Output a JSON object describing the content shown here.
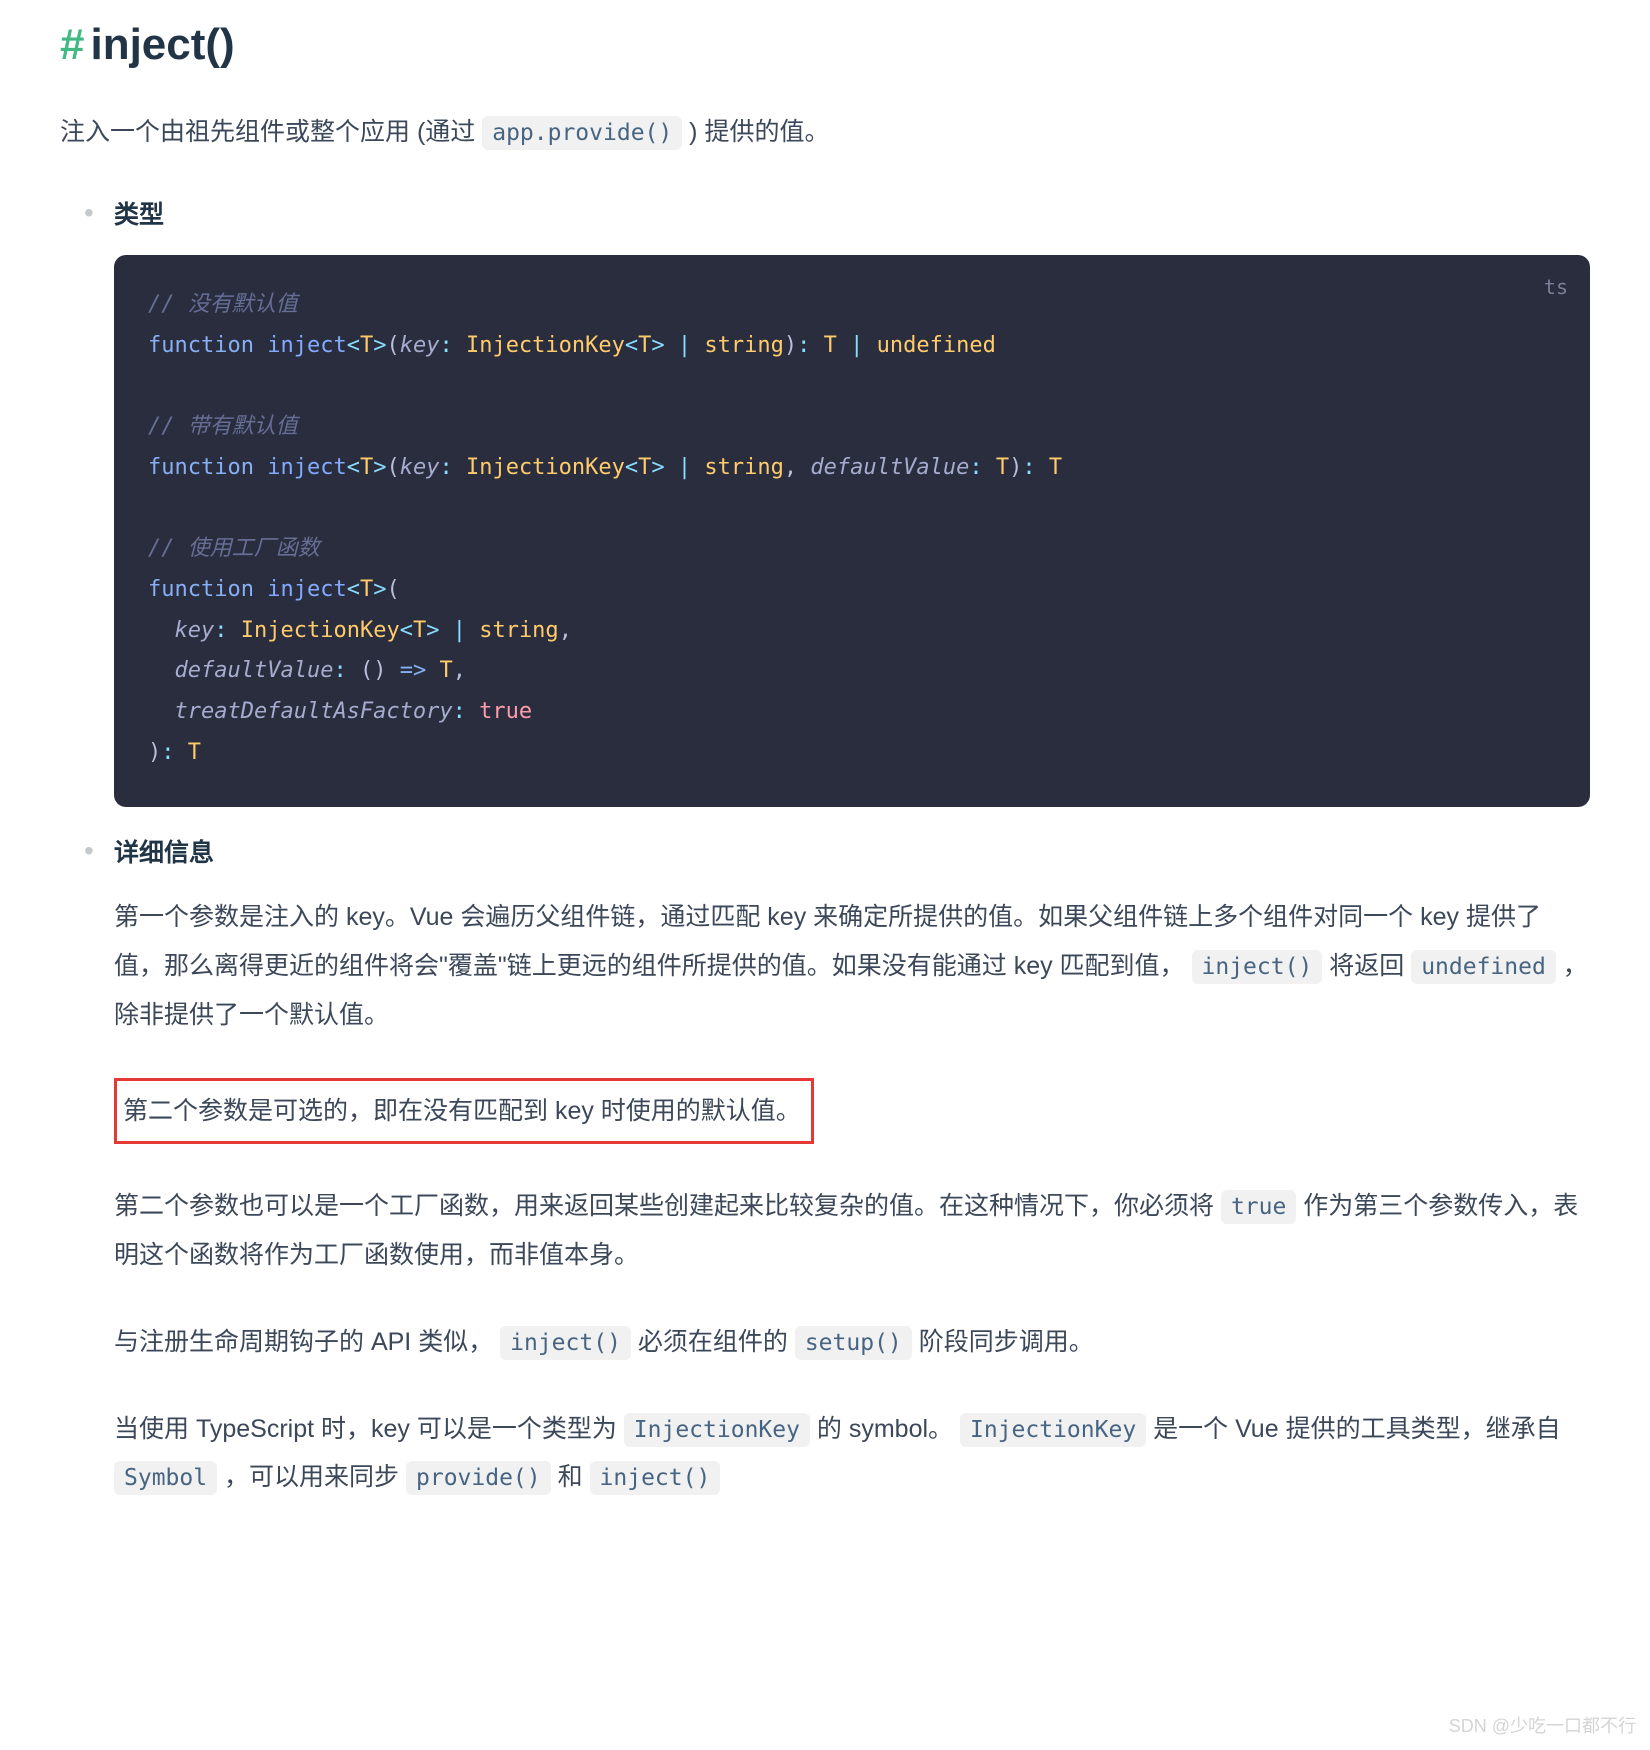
{
  "heading": {
    "hash": "#",
    "title": "inject()"
  },
  "intro": {
    "before": "注入一个由祖先组件或整个应用 (通过 ",
    "code": "app.provide()",
    "after": " ) 提供的值。"
  },
  "sections": {
    "type_label": "类型",
    "details_label": "详细信息"
  },
  "code": {
    "lang": "ts",
    "c1": "// 没有默认值",
    "l1_kw": "function",
    "l1_fn": "inject",
    "l1_lt": "<",
    "l1_T": "T",
    "l1_gt": ">",
    "l1_open": "(",
    "l1_key": "key",
    "l1_colon1": ":",
    "l1_sp": " ",
    "l1_InjK": "InjectionKey",
    "l1_lt2": "<",
    "l1_T2": "T",
    "l1_gt2": ">",
    "l1_pipe": " | ",
    "l1_string": "string",
    "l1_close": ")",
    "l1_colon2": ":",
    "l1_T3": "T",
    "l1_pipe2": " | ",
    "l1_undef": "undefined",
    "c2": "// 带有默认值",
    "l2_kw": "function",
    "l2_fn": "inject",
    "l2_key": "key",
    "l2_InjK": "InjectionKey",
    "l2_string": "string",
    "l2_defv": "defaultValue",
    "l2_T": "T",
    "c3": "// 使用工厂函数",
    "l3_kw": "function",
    "l3_fn": "inject",
    "l3_key": "key",
    "l3_InjK": "InjectionKey",
    "l3_string": "string",
    "l3_defv": "defaultValue",
    "l3_arrow": "=>",
    "l3_treat": "treatDefaultAsFactory",
    "l3_true": "true",
    "l3_T": "T"
  },
  "details": {
    "p1_a": "第一个参数是注入的 key。Vue 会遍历父组件链，通过匹配 key 来确定所提供的值。如果父组件链上多个组件对同一个 key 提供了值，那么离得更近的组件将会\"覆盖\"链上更远的组件所提供的值。如果没有能通过 key 匹配到值， ",
    "p1_code1": "inject()",
    "p1_b": " 将返回 ",
    "p1_code2": "undefined",
    "p1_c": " ，除非提供了一个默认值。",
    "p2": "第二个参数是可选的，即在没有匹配到 key 时使用的默认值。",
    "p3_a": "第二个参数也可以是一个工厂函数，用来返回某些创建起来比较复杂的值。在这种情况下，你必须将 ",
    "p3_code1": "true",
    "p3_b": " 作为第三个参数传入，表明这个函数将作为工厂函数使用，而非值本身。",
    "p4_a": "与注册生命周期钩子的 API 类似， ",
    "p4_code1": "inject()",
    "p4_b": " 必须在组件的 ",
    "p4_code2": "setup()",
    "p4_c": " 阶段同步调用。",
    "p5_a": "当使用 TypeScript 时，key 可以是一个类型为 ",
    "p5_code1": "InjectionKey",
    "p5_b": " 的 symbol。 ",
    "p5_code2": "InjectionKey",
    "p5_c": " 是一个 Vue 提供的工具类型，继承自 ",
    "p5_code3": "Symbol",
    "p5_d": " ，可以用来同步 ",
    "p5_code4": "provide()",
    "p5_e": " 和 ",
    "p5_code5": "inject()"
  },
  "watermark": "SDN @少吃一口都不行"
}
